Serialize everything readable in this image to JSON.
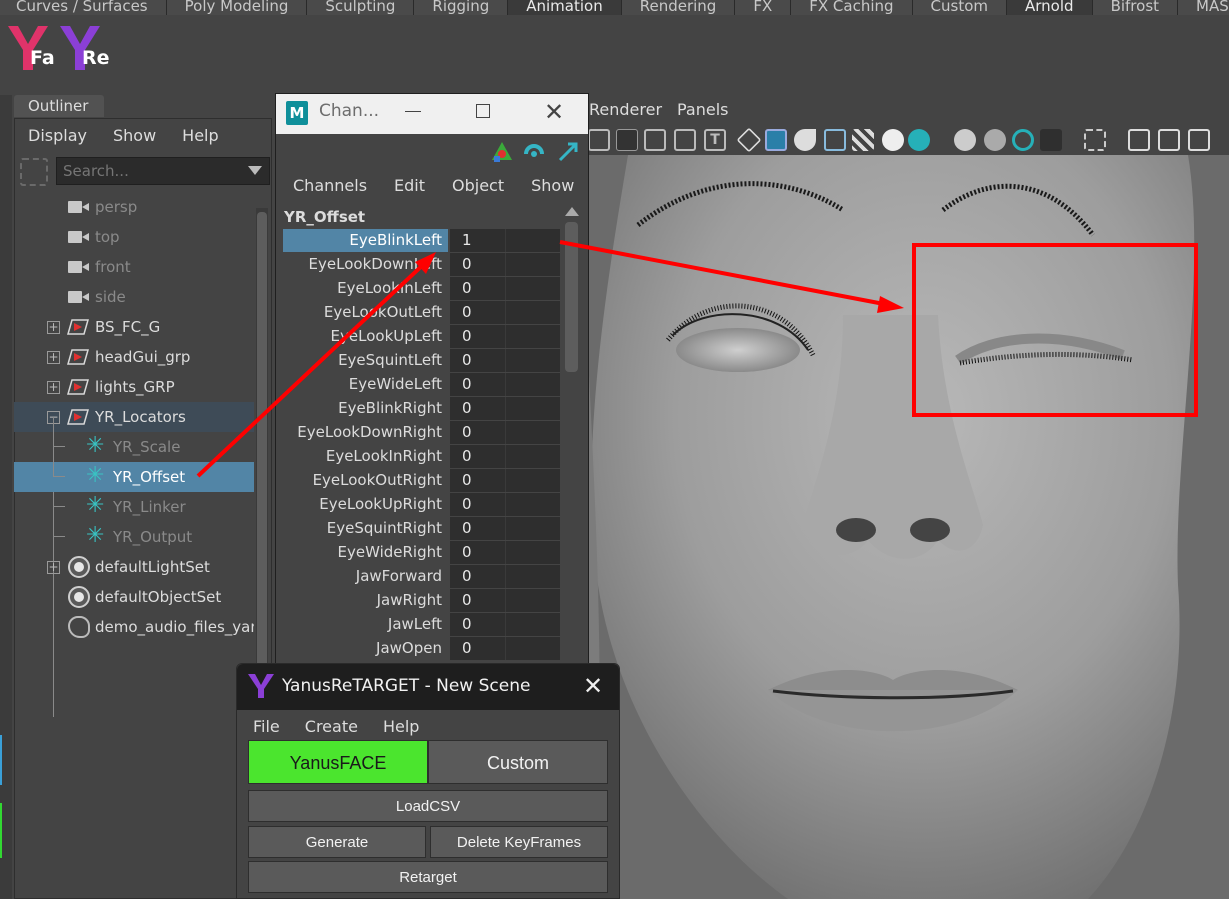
{
  "shelf": {
    "tabs": [
      {
        "label": "Curves / Surfaces"
      },
      {
        "label": "Poly Modeling"
      },
      {
        "label": "Sculpting"
      },
      {
        "label": "Rigging"
      },
      {
        "label": "Animation"
      },
      {
        "label": "Rendering"
      },
      {
        "label": "FX"
      },
      {
        "label": "FX Caching"
      },
      {
        "label": "Custom"
      },
      {
        "label": "Arnold"
      },
      {
        "label": "Bifrost"
      },
      {
        "label": "MASH"
      }
    ]
  },
  "logo": {
    "left": "Fa",
    "right": "Re",
    "colors": {
      "pink": "#e0336a",
      "purple": "#8b3fd6"
    }
  },
  "outliner": {
    "tab_label": "Outliner",
    "menu": {
      "display": "Display",
      "show": "Show",
      "help": "Help"
    },
    "search_placeholder": "Search...",
    "items": [
      {
        "label": "persp"
      },
      {
        "label": "top"
      },
      {
        "label": "front"
      },
      {
        "label": "side"
      },
      {
        "label": "BS_FC_G"
      },
      {
        "label": "headGui_grp"
      },
      {
        "label": "lights_GRP"
      },
      {
        "label": "YR_Locators"
      },
      {
        "label": "YR_Scale"
      },
      {
        "label": "YR_Offset"
      },
      {
        "label": "YR_Linker"
      },
      {
        "label": "YR_Output"
      },
      {
        "label": "defaultLightSet"
      },
      {
        "label": "defaultObjectSet"
      },
      {
        "label": "demo_audio_files_yanu"
      }
    ]
  },
  "channel_box": {
    "title": "Chan...",
    "menu": {
      "channels": "Channels",
      "edit": "Edit",
      "object": "Object",
      "show": "Show"
    },
    "object_name": "YR_Offset",
    "channels": [
      {
        "name": "EyeBlinkLeft",
        "value": "1"
      },
      {
        "name": "EyeLookDownLeft",
        "value": "0"
      },
      {
        "name": "EyeLookInLeft",
        "value": "0"
      },
      {
        "name": "EyeLookOutLeft",
        "value": "0"
      },
      {
        "name": "EyeLookUpLeft",
        "value": "0"
      },
      {
        "name": "EyeSquintLeft",
        "value": "0"
      },
      {
        "name": "EyeWideLeft",
        "value": "0"
      },
      {
        "name": "EyeBlinkRight",
        "value": "0"
      },
      {
        "name": "EyeLookDownRight",
        "value": "0"
      },
      {
        "name": "EyeLookInRight",
        "value": "0"
      },
      {
        "name": "EyeLookOutRight",
        "value": "0"
      },
      {
        "name": "EyeLookUpRight",
        "value": "0"
      },
      {
        "name": "EyeSquintRight",
        "value": "0"
      },
      {
        "name": "EyeWideRight",
        "value": "0"
      },
      {
        "name": "JawForward",
        "value": "0"
      },
      {
        "name": "JawRight",
        "value": "0"
      },
      {
        "name": "JawLeft",
        "value": "0"
      },
      {
        "name": "JawOpen",
        "value": "0"
      }
    ]
  },
  "viewport": {
    "menu": {
      "renderer": "Renderer",
      "panels": "Panels"
    },
    "highlight_color": "#ff0000"
  },
  "yanus": {
    "title": "YanusReTARGET - New Scene",
    "menu": {
      "file": "File",
      "create": "Create",
      "help": "Help"
    },
    "buttons": {
      "yanusface": "YanusFACE",
      "custom": "Custom",
      "loadcsv": "LoadCSV",
      "generate": "Generate",
      "delete_keyframes": "Delete KeyFrames",
      "retarget": "Retarget"
    },
    "accent": "#4be52e"
  }
}
